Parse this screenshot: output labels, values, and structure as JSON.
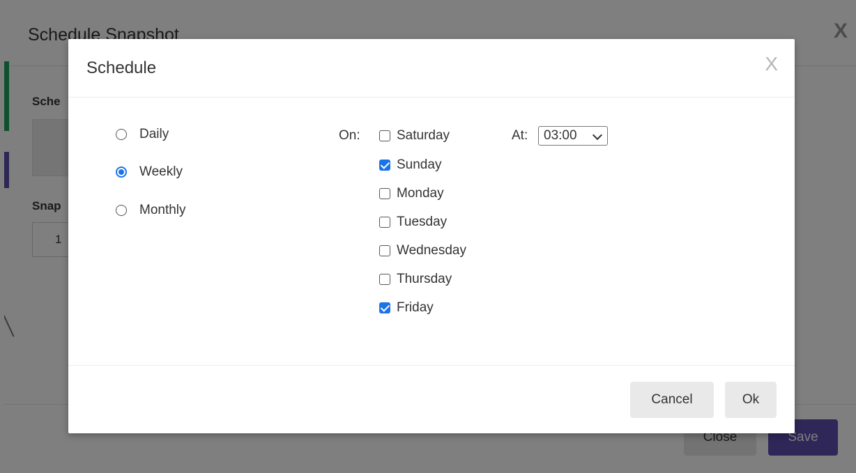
{
  "background_dialog": {
    "title": "Schedule Snapshot",
    "close_glyph": "X",
    "label_schedule": "Sche",
    "label_snapshots": "Snap",
    "count_value": "1",
    "close_button": "Close",
    "save_button": "Save"
  },
  "modal": {
    "title": "Schedule",
    "close_glyph": "X",
    "frequency": [
      {
        "label": "Daily",
        "checked": false
      },
      {
        "label": "Weekly",
        "checked": true
      },
      {
        "label": "Monthly",
        "checked": false
      }
    ],
    "on_label": "On:",
    "days": [
      {
        "label": "Saturday",
        "checked": false
      },
      {
        "label": "Sunday",
        "checked": true
      },
      {
        "label": "Monday",
        "checked": false
      },
      {
        "label": "Tuesday",
        "checked": false
      },
      {
        "label": "Wednesday",
        "checked": false
      },
      {
        "label": "Thursday",
        "checked": false
      },
      {
        "label": "Friday",
        "checked": true
      }
    ],
    "at_label": "At:",
    "time_value": "03:00",
    "cancel_button": "Cancel",
    "ok_button": "Ok"
  },
  "icons": {
    "modal_close": "close-icon",
    "select_arrow": "chevron-down-icon"
  },
  "colors": {
    "accent": "#1a73e8",
    "save": "#5c4fb0",
    "green_tab": "#1ea05a"
  }
}
